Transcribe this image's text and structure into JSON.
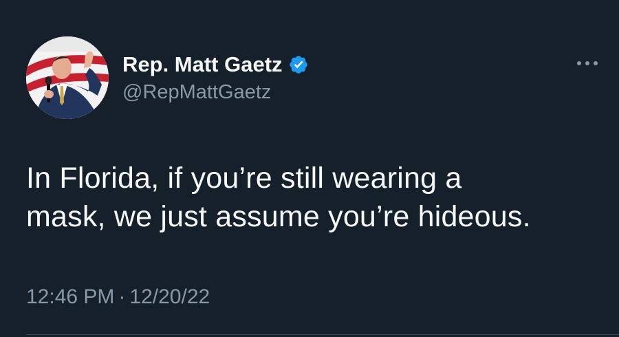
{
  "tweet": {
    "author": {
      "display_name": "Rep. Matt Gaetz",
      "handle": "@RepMattGaetz",
      "verified": true,
      "avatar_icon": "profile-photo"
    },
    "text_lines": [
      "In Florida, if you’re still wearing a",
      "mask, we just assume you’re hideous."
    ],
    "time": "12:46 PM",
    "separator": "·",
    "date": "12/20/22",
    "more_icon": "ellipsis-icon"
  },
  "colors": {
    "background": "#15202b",
    "primary_text": "#f7f9f9",
    "secondary_text": "#8b98a5",
    "verified_badge": "#1d9bf0",
    "divider": "#38444d"
  }
}
